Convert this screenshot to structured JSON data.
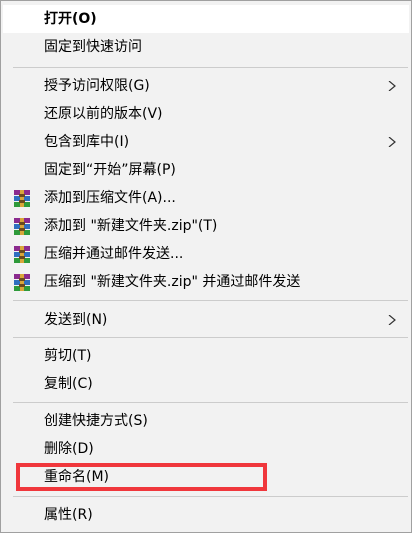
{
  "menu": {
    "open": "打开(O)",
    "pin_quick_access": "固定到快速访问",
    "grant_access": "授予访问权限(G)",
    "restore_previous": "还原以前的版本(V)",
    "include_in_library": "包含到库中(I)",
    "pin_start": "固定到“开始”屏幕(P)",
    "add_to_archive": "添加到压缩文件(A)...",
    "add_to_zip": "添加到 \"新建文件夹.zip\"(T)",
    "compress_email": "压缩并通过邮件发送...",
    "compress_zip_email": "压缩到 \"新建文件夹.zip\" 并通过邮件发送",
    "send_to": "发送到(N)",
    "cut": "剪切(T)",
    "copy": "复制(C)",
    "create_shortcut": "创建快捷方式(S)",
    "delete": "删除(D)",
    "rename": "重命名(M)",
    "properties": "属性(R)"
  },
  "icons": {
    "submenu": "chevron-right-icon",
    "archive": "winrar-icon"
  },
  "colors": {
    "menu_background": "#f2f2f2",
    "highlight_background": "#ffffff",
    "separator": "#cccccc",
    "annotation_box": "#f0373c"
  }
}
